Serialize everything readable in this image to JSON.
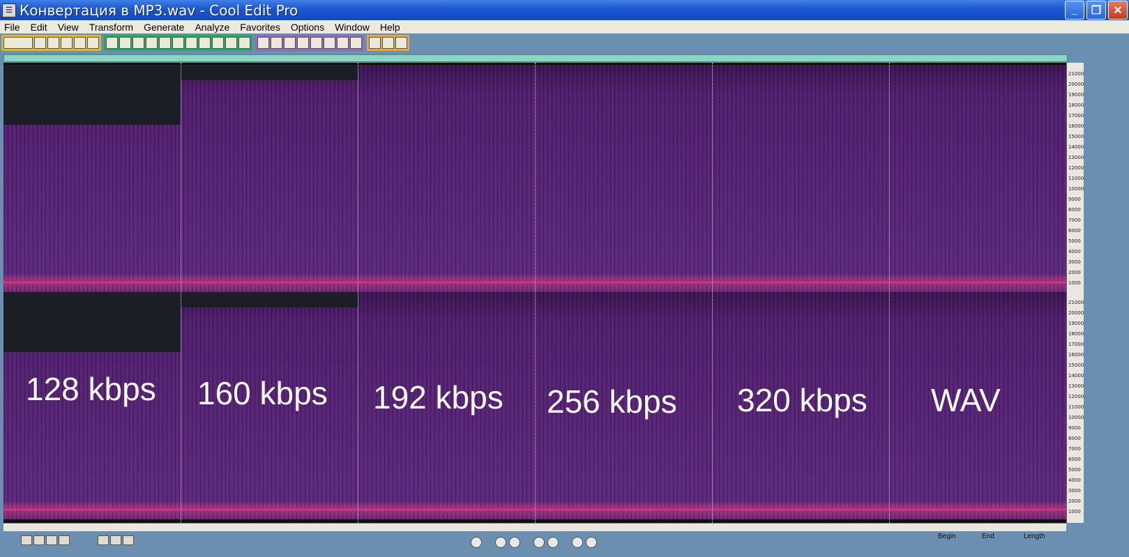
{
  "window": {
    "title": "Конвертация в MP3.wav - Cool Edit Pro",
    "minimize_label": "_",
    "maximize_label": "❐",
    "close_label": "✕",
    "app_icon_glyph": "☰"
  },
  "menu": [
    {
      "label": "File"
    },
    {
      "label": "Edit"
    },
    {
      "label": "View"
    },
    {
      "label": "Transform"
    },
    {
      "label": "Generate"
    },
    {
      "label": "Analyze"
    },
    {
      "label": "Favorites"
    },
    {
      "label": "Options"
    },
    {
      "label": "Window"
    },
    {
      "label": "Help"
    }
  ],
  "spectrogram": {
    "labels": [
      "128 kbps",
      "160 kbps",
      "192 kbps",
      "256 kbps",
      "320 kbps",
      "WAV"
    ],
    "freq_ticks": [
      "21000",
      "20000",
      "19000",
      "18000",
      "17000",
      "16000",
      "15000",
      "14000",
      "13000",
      "12000",
      "11000",
      "10000",
      "9000",
      "8000",
      "7000",
      "6000",
      "5000",
      "4000",
      "3000",
      "2000",
      "1000"
    ],
    "colors": {
      "spectrum": "#5a2678",
      "cutoff": "#1c1e25",
      "low_band": "#d23a86"
    }
  },
  "status": {
    "begin_label": "Begin",
    "end_label": "End",
    "length_label": "Length"
  }
}
